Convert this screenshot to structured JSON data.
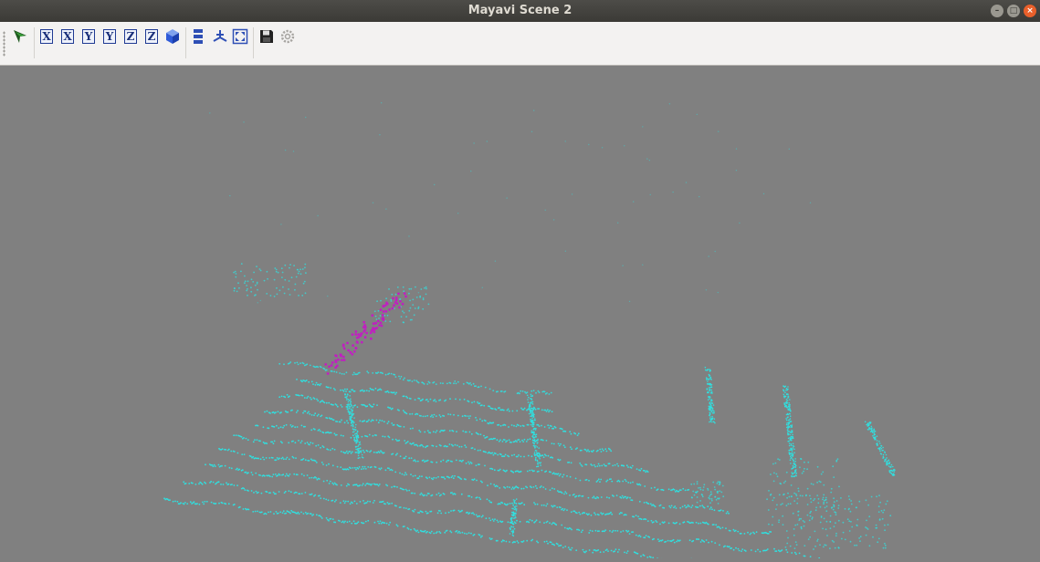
{
  "window": {
    "title": "Mayavi Scene 2",
    "buttons": {
      "minimize": "–",
      "maximize": "□",
      "close": "×"
    }
  },
  "toolbar": {
    "buttons": [
      {
        "name": "mayavi-pipeline-icon"
      },
      {
        "name": "view-x-plus-icon",
        "label": "X"
      },
      {
        "name": "view-x-minus-icon",
        "label": "X"
      },
      {
        "name": "view-y-plus-icon",
        "label": "Y"
      },
      {
        "name": "view-y-minus-icon",
        "label": "Y"
      },
      {
        "name": "view-z-plus-icon",
        "label": "Z"
      },
      {
        "name": "view-z-minus-icon",
        "label": "Z"
      },
      {
        "name": "isometric-view-icon"
      },
      {
        "name": "toggle-parallel-projection-icon"
      },
      {
        "name": "toggle-axes-icon"
      },
      {
        "name": "full-screen-icon"
      },
      {
        "name": "save-scene-icon"
      },
      {
        "name": "configure-scene-icon"
      }
    ]
  },
  "scene": {
    "background_color": "#808080",
    "point_colors": {
      "ground": "#2fe0e0",
      "highlight": "#c020c0"
    }
  }
}
